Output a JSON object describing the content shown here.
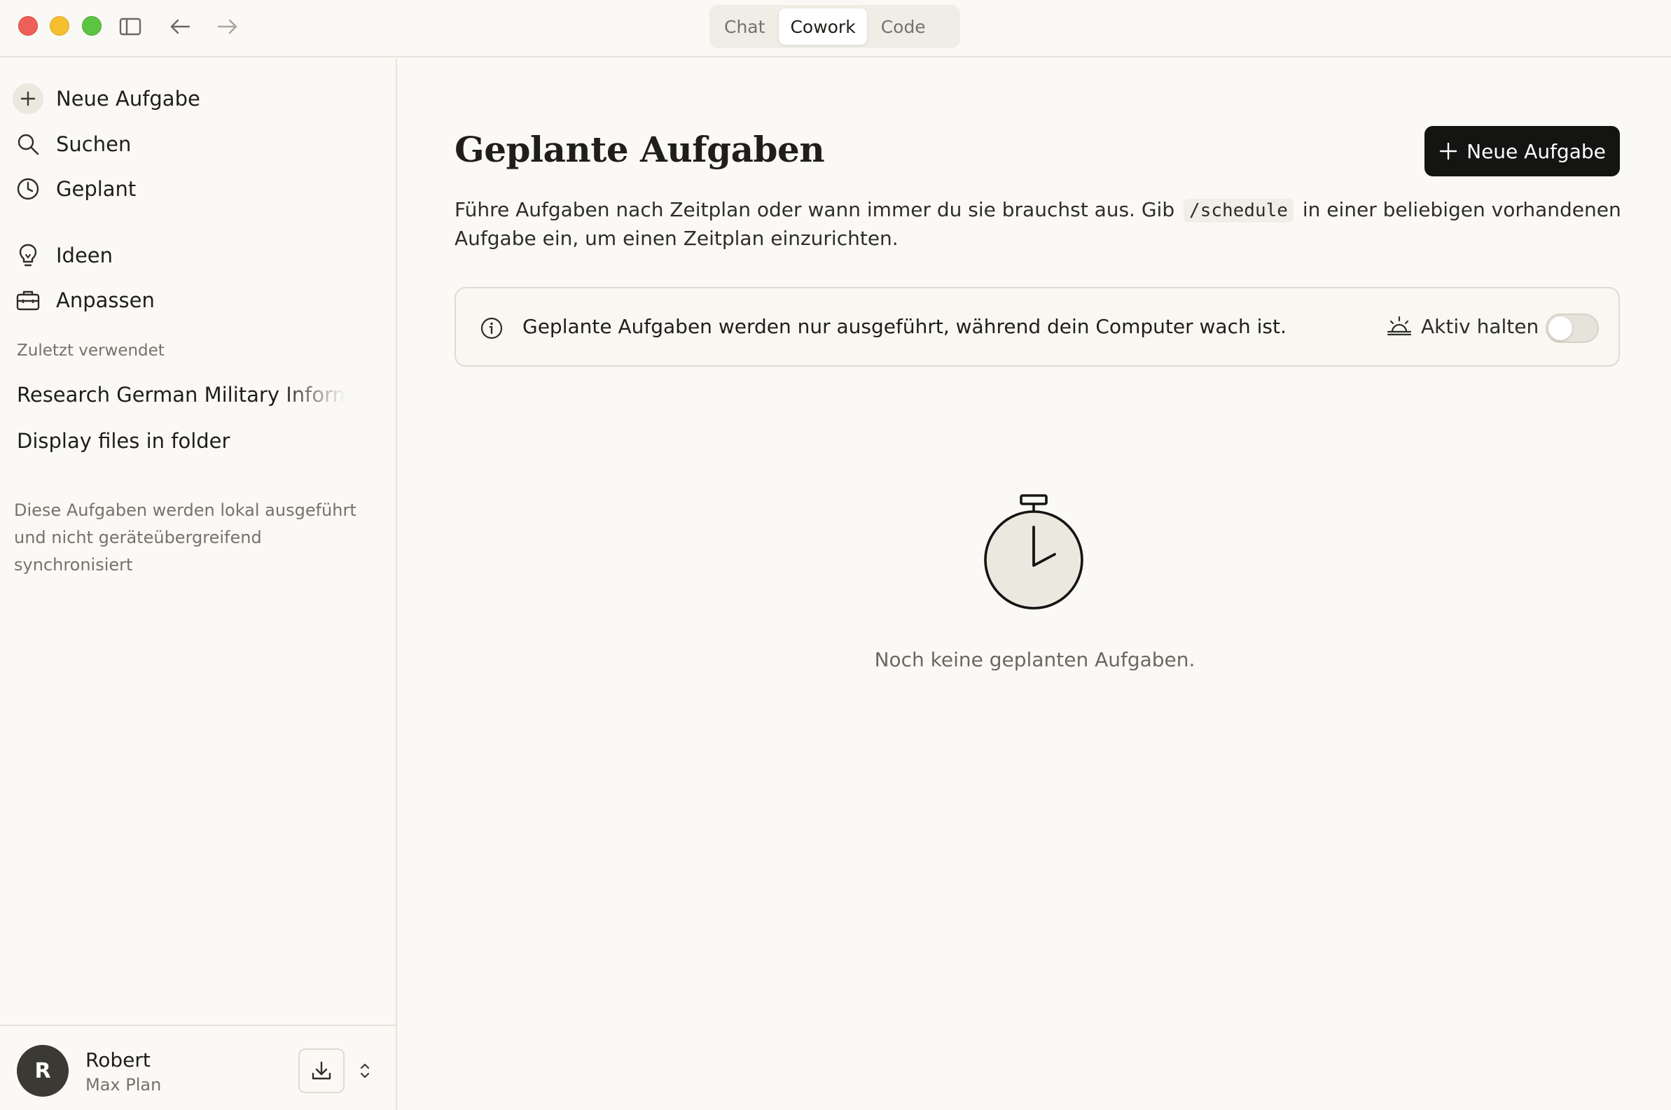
{
  "window": {
    "mode_tabs": [
      {
        "label": "Chat",
        "active": false
      },
      {
        "label": "Cowork",
        "active": true
      },
      {
        "label": "Code",
        "active": false
      }
    ]
  },
  "sidebar": {
    "nav_items": [
      {
        "label": "Neue Aufgabe",
        "icon": "plus-icon"
      },
      {
        "label": "Suchen",
        "icon": "search-icon"
      },
      {
        "label": "Geplant",
        "icon": "clock-icon"
      },
      {
        "label": "Ideen",
        "icon": "lightbulb-icon"
      },
      {
        "label": "Anpassen",
        "icon": "toolbox-icon"
      }
    ],
    "recent_label": "Zuletzt verwendet",
    "recent_items": [
      "Research German Military Informati",
      "Display files in folder"
    ],
    "note": "Diese Aufgaben werden lokal ausgeführt und nicht geräteübergreifend synchronisiert",
    "user": {
      "initial": "R",
      "name": "Robert",
      "plan": "Max Plan"
    }
  },
  "main": {
    "title": "Geplante Aufgaben",
    "new_task_button": "Neue Aufgabe",
    "description_before": "Führe Aufgaben nach Zeitplan oder wann immer du sie brauchst aus. Gib",
    "description_code": "/schedule",
    "description_after": "in einer beliebigen vorhandenen Aufgabe ein, um einen Zeitplan einzurichten.",
    "banner": {
      "text": "Geplante Aufgaben werden nur ausgeführt, während dein Computer wach ist.",
      "keep_awake_label": "Aktiv halten",
      "keep_awake_enabled": false
    },
    "empty_state": "Noch keine geplanten Aufgaben."
  },
  "colors": {
    "background": "#faf9f5",
    "primary_button": "#141413",
    "border": "#e6e3da",
    "muted_text": "#75726b"
  }
}
